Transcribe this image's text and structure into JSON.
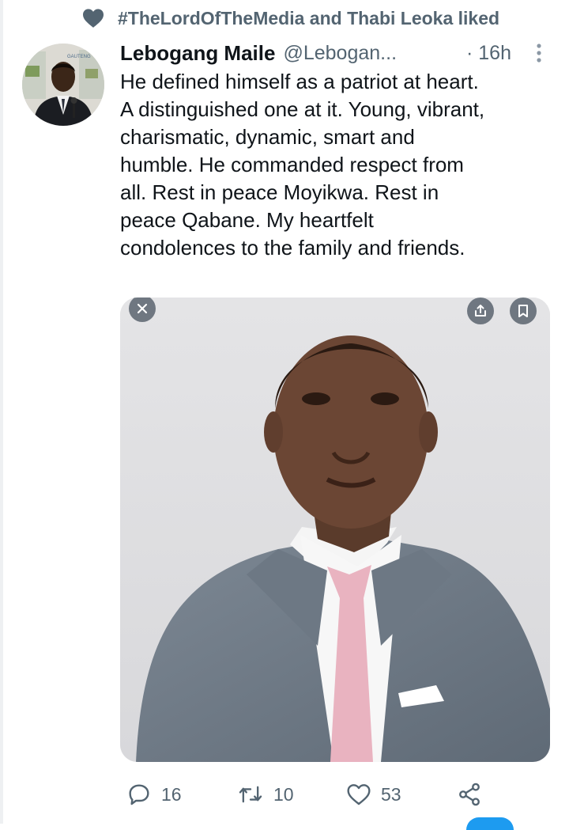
{
  "social_context": {
    "text": "#TheLordOfTheMedia and Thabi Leoka liked",
    "icon": "heart-icon"
  },
  "tweet": {
    "author_name": "Lebogang Maile",
    "author_handle": "@Lebogan...",
    "timestamp": "· 16h",
    "text_lines": [
      "He defined himself as a patriot at heart.",
      "A distinguished one at it. Young, vibrant,",
      "charismatic, dynamic, smart and",
      "humble. He commanded respect from",
      "all. Rest in peace Moyikwa. Rest in",
      "peace Qabane. My heartfelt",
      "condolences to the family and friends."
    ],
    "avatar_text": "GAUTENG"
  },
  "actions": {
    "reply_count": "16",
    "retweet_count": "10",
    "like_count": "53"
  },
  "colors": {
    "primary_text": "#0f1419",
    "secondary_text": "#536471",
    "accent": "#1d9bf0"
  }
}
